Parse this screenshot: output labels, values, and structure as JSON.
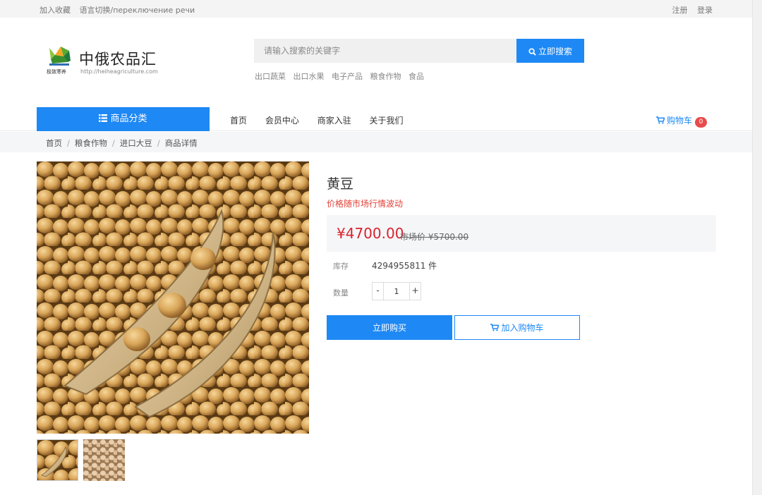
{
  "topbar": {
    "left_links": [
      "加入收藏",
      "语言切换/переключение речи"
    ],
    "right_links": [
      "注册",
      "登录"
    ]
  },
  "logo": {
    "title": "中俄农品汇",
    "url": "http://heiheagriculture.com",
    "mark_caption": "极致寒养"
  },
  "search": {
    "placeholder": "请输入搜索的关键字",
    "value": "",
    "button_label": "立即搜索",
    "hot_words": [
      "出口蔬菜",
      "出口水果",
      "电子产品",
      "粮食作物",
      "食品"
    ]
  },
  "nav": {
    "category_label": "商品分类",
    "links": [
      "首页",
      "会员中心",
      "商家入驻",
      "关于我们"
    ],
    "cart_label": "购物车",
    "cart_count": "0"
  },
  "breadcrumb": [
    "首页",
    "粮食作物",
    "进口大豆",
    "商品详情"
  ],
  "product": {
    "name": "黄豆",
    "tip": "价格随市场行情波动",
    "price": "¥4700.00",
    "market_price": "市场价 ¥5700.00",
    "stock_label": "库存",
    "stock_value": "4294955811 件",
    "qty_label": "数量",
    "qty_value": "1",
    "qty_minus": "-",
    "qty_plus": "+",
    "buy_label": "立即购买",
    "add_cart_label": "加入购物车"
  },
  "colors": {
    "accent": "#1e88f5",
    "price": "#d9232d",
    "tip": "#e1423a",
    "badge": "#e74c4c"
  },
  "icons": {
    "search": "search-icon",
    "category": "list-icon",
    "cart": "cart-icon"
  }
}
